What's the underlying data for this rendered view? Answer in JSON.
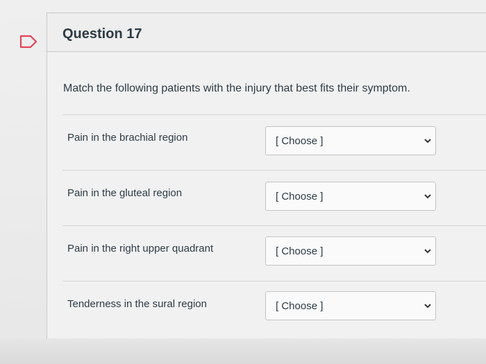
{
  "question": {
    "title": "Question 17",
    "instructions": "Match the following patients with the injury that best fits their symptom."
  },
  "rows": [
    {
      "label": "Pain in the brachial region",
      "selected": "[ Choose ]"
    },
    {
      "label": "Pain in the gluteal region",
      "selected": "[ Choose ]"
    },
    {
      "label": "Pain in the right upper quadrant",
      "selected": "[ Choose ]"
    },
    {
      "label": "Tenderness in the sural region",
      "selected": "[ Choose ]"
    }
  ],
  "icons": {
    "flag": "flag-icon",
    "dropdown": "chevron-down-icon"
  },
  "colors": {
    "text": "#2d3b45",
    "flag": "#e0445a"
  }
}
